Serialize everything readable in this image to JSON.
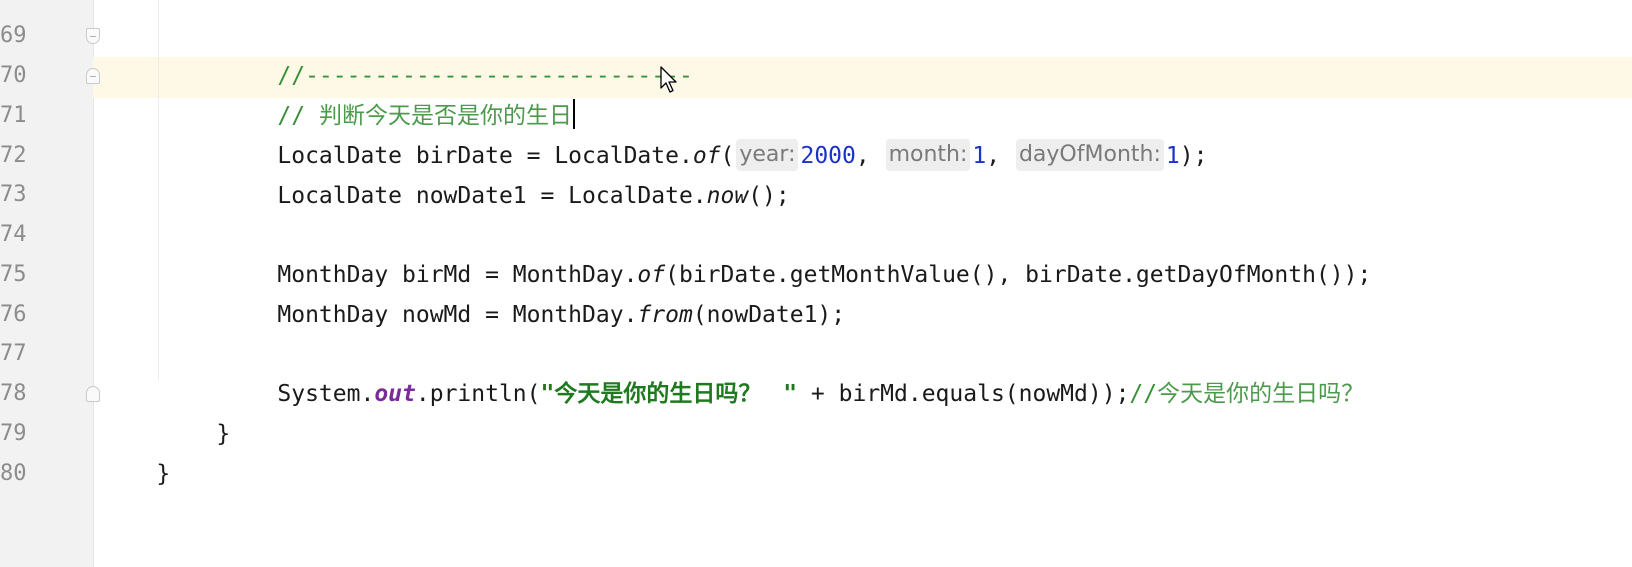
{
  "gutter": {
    "line_numbers": [
      "69",
      "70",
      "71",
      "72",
      "73",
      "74",
      "75",
      "76",
      "77",
      "78",
      "79",
      "80"
    ]
  },
  "code": {
    "l69": {
      "comment": "//----------------------------"
    },
    "l70": {
      "comment_prefix": "// ",
      "comment_text": "判断今天是否是你的生日"
    },
    "l71": {
      "p1": "LocalDate birDate = LocalDate.",
      "method": "of",
      "p2": "(",
      "hint_year": "year:",
      "v_year": "2000",
      "sep1": ", ",
      "hint_month": "month:",
      "v_month": "1",
      "sep2": ", ",
      "hint_day": "dayOfMonth:",
      "v_day": "1",
      "p3": ");"
    },
    "l72": {
      "p1": "LocalDate nowDate1 = LocalDate.",
      "method": "now",
      "p2": "();"
    },
    "l74": {
      "p1": "MonthDay birMd = MonthDay.",
      "method": "of",
      "p2": "(birDate.getMonthValue(), birDate.getDayOfMonth());"
    },
    "l75": {
      "p1": "MonthDay nowMd = MonthDay.",
      "method": "from",
      "p2": "(nowDate1);"
    },
    "l77": {
      "p1": "System.",
      "field": "out",
      "p2": ".println(",
      "str_open": "\"",
      "str_text": "今天是你的生日吗？ ",
      "str_close": " \"",
      "p3": " + birMd.equals(nowMd));",
      "comment_prefix": "//",
      "comment_text": "今天是你的生日吗？"
    },
    "l78": {
      "text": "}"
    },
    "l79": {
      "text": "}"
    }
  },
  "colors": {
    "comment": "#3a8f3a",
    "keyword_number": "#1a32c8",
    "string": "#1f7a1f",
    "field": "#7b2b9e",
    "current_line": "#fdf9e6",
    "gutter": "#f2f2f2"
  },
  "icons": {
    "fold_markers": [
      "fold-start-icon",
      "fold-end-icon"
    ],
    "pointer": "mouse-pointer-icon"
  }
}
